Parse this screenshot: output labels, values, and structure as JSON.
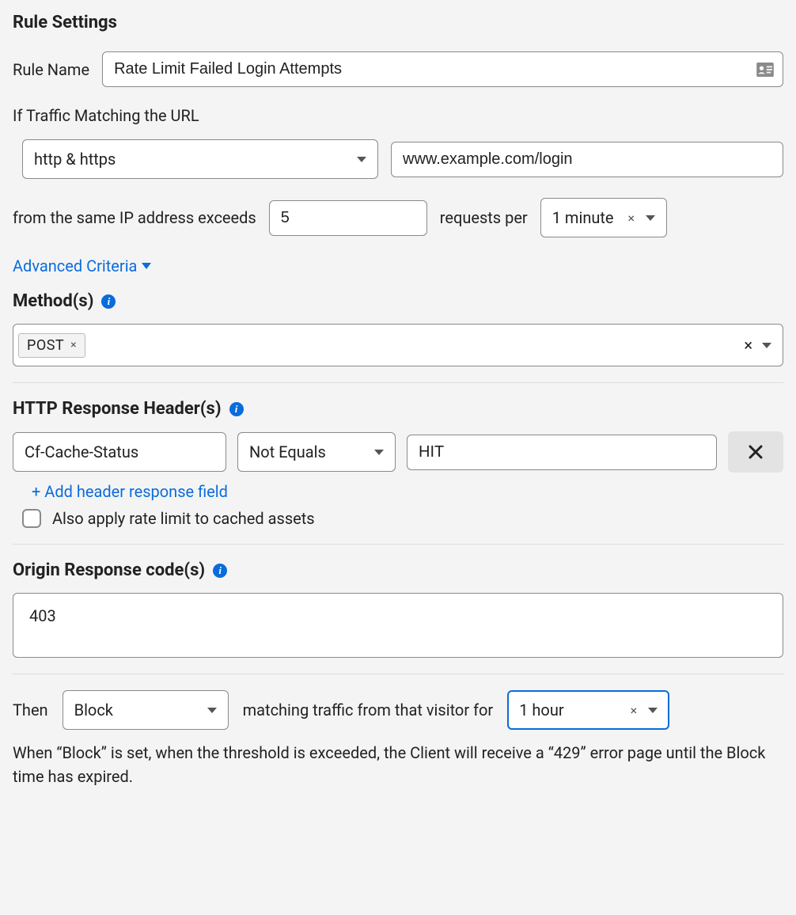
{
  "heading": "Rule Settings",
  "rule_name_label": "Rule Name",
  "rule_name_value": "Rate Limit Failed Login Attempts",
  "traffic_label": "If Traffic Matching the URL",
  "scheme_value": "http & https",
  "url_value": "www.example.com/login",
  "from_ip_prefix": "from the same IP address exceeds",
  "threshold_value": "5",
  "requests_per_label": "requests per",
  "period_value": "1 minute",
  "advanced_criteria": "Advanced Criteria",
  "methods": {
    "heading": "Method(s)",
    "tags": [
      "POST"
    ]
  },
  "response_header": {
    "heading": "HTTP Response Header(s)",
    "name": "Cf-Cache-Status",
    "operator": "Not Equals",
    "value": "HIT",
    "add_link": "+ Add header response field",
    "cached_checkbox_label": "Also apply rate limit to cached assets"
  },
  "origin_codes": {
    "heading": "Origin Response code(s)",
    "value": "403"
  },
  "then": {
    "label": "Then",
    "action": "Block",
    "middle": "matching traffic from that visitor for",
    "duration": "1 hour",
    "help": "When “Block” is set, when the threshold is exceeded, the Client will receive a “429” error page until the Block time has expired."
  }
}
